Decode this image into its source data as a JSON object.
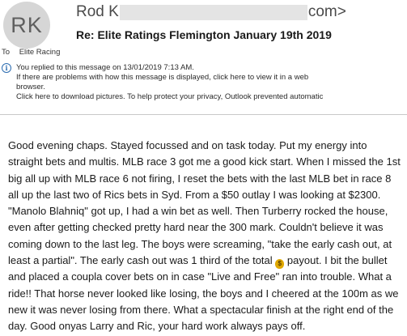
{
  "header": {
    "avatar_initials": "RK",
    "sender_prefix": "Rod K",
    "sender_suffix": "com>",
    "subject": "Re: Elite Ratings Flemington January 19th 2019",
    "to_label": "To",
    "to_value": "Elite Racing"
  },
  "notice": {
    "icon": "info-icon",
    "line1": "You replied to this message on 13/01/2019 7:13 AM.",
    "line2": "If there are problems with how this message is displayed, click here to view it in a web",
    "line3": "browser.",
    "line4": "Click here to download pictures. To help protect your privacy, Outlook prevented automatic"
  },
  "message": {
    "text_before_icon": "Good evening chaps. Stayed focussed and on task today. Put my energy into straight bets and multis. MLB race 3 got me a good kick start. When I missed the 1st big all up with MLB race 6 not firing, I reset the bets with the last MLB bet in race 8 all up the last two of Rics bets in Syd. From a $50 outlay I was looking at $2300. \"Manolo Blahniq\" got up, I had a win bet as well. Then Turberry rocked the house, even after getting checked pretty hard near the 300 mark. Couldn't believe it was coming down to the last leg. The boys were screaming, \"take the early cash out, at least a partial\". The early cash out was 1 third of the total ",
    "inline_icon": "moneybag-icon",
    "text_after_icon": " payout. I bit the bullet and placed a coupla cover bets on in case \"Live and Free\" ran into trouble. What a ride!! That horse never looked like losing, the boys and I cheered at the 100m as we new it was never losing from there. What a spectacular finish at the right end of the day. Good onyas Larry and Ric, your hard work always pays off."
  },
  "colors": {
    "avatar_bg": "#d6d6d6",
    "info_icon": "#2b6cb0",
    "moneybag": "#e0a800"
  }
}
